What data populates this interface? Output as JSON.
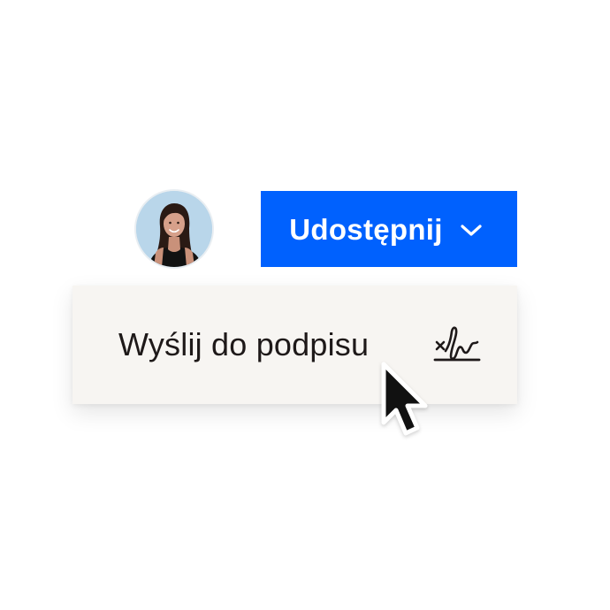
{
  "share": {
    "label": "Udostępnij",
    "icon": "chevron-down-icon"
  },
  "menu": {
    "items": [
      {
        "label": "Wyślij do podpisu",
        "icon": "signature-icon"
      }
    ]
  },
  "avatar": {
    "icon": "user-photo"
  },
  "cursor": {
    "icon": "arrow-cursor-icon"
  },
  "colors": {
    "accent": "#0061fe",
    "menu_background": "#f7f5f2",
    "text": "#1e1919",
    "avatar_background": "#b9d6ea"
  }
}
